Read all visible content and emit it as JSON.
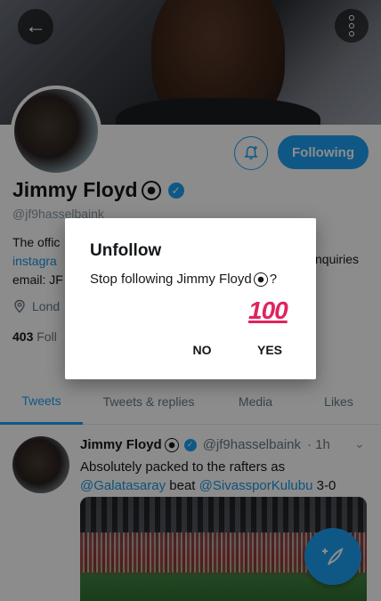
{
  "profile": {
    "display_name": "Jimmy Floyd",
    "handle": "@jf9hasselbaink",
    "bio_line1": "The offic",
    "bio_link": "instagra",
    "bio_line3": "email: JF",
    "bio_right": "nquiries",
    "location": "Lond",
    "stats_count": "403",
    "stats_label": "Foll",
    "follow_button": "Following"
  },
  "tabs": [
    {
      "label": "Tweets"
    },
    {
      "label": "Tweets & replies"
    },
    {
      "label": "Media"
    },
    {
      "label": "Likes"
    }
  ],
  "tweet": {
    "name": "Jimmy Floyd",
    "handle": "@jf9hasselbaink",
    "time": "· 1h",
    "text_1": "Absolutely packed to the rafters as",
    "mention_1": "@Galatasaray",
    "text_2": "beat",
    "mention_2": "@SivassporKulubu",
    "text_3": "3-0"
  },
  "dialog": {
    "title": "Unfollow",
    "message": "Stop following Jimmy Floyd",
    "message_end": "?",
    "emoji_text": "100",
    "no_label": "NO",
    "yes_label": "YES"
  },
  "colors": {
    "accent": "#1da1f2",
    "link": "#1b95e0",
    "muted": "#657786"
  }
}
